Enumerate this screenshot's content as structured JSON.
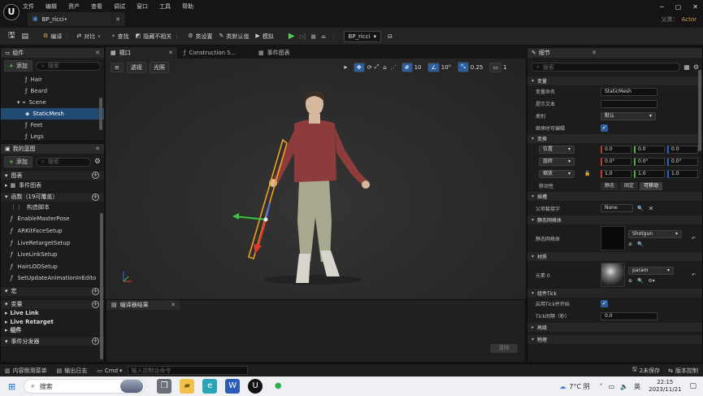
{
  "window": {
    "menu": [
      "文件",
      "编辑",
      "资产",
      "查看",
      "调试",
      "窗口",
      "工具",
      "帮助"
    ],
    "tab_title": "BP_ricci•",
    "parent_class_label": "父类：",
    "parent_class_value": "Actor",
    "logo_text": "U"
  },
  "toolbar": {
    "compile": "编译",
    "diff": "对比",
    "find": "查找",
    "hide_unrelated": "隐藏不相关",
    "class_settings": "类设置",
    "class_defaults": "类默认值",
    "simulate": "模拟",
    "debug_target": "BP_ricci"
  },
  "components": {
    "title": "组件",
    "add": "添加",
    "search_placeholder": "搜索",
    "items": [
      {
        "label": "Hair",
        "indent": 3
      },
      {
        "label": "Beard",
        "indent": 3
      },
      {
        "label": "Scene",
        "indent": 2
      },
      {
        "label": "StaticMesh",
        "indent": 3,
        "selected": true
      },
      {
        "label": "Feet",
        "indent": 3
      },
      {
        "label": "Legs",
        "indent": 3
      }
    ]
  },
  "my_blueprint": {
    "title": "我的蓝图",
    "add": "添加",
    "search_placeholder": "搜索",
    "graphs_header": "图表",
    "event_graph": "事件图表",
    "functions_header": "函数（19可覆盖）",
    "functions": [
      "构造脚本",
      "EnableMasterPose",
      "ARKitFaceSetup",
      "LiveRetargetSetup",
      "LiveLinkSetup",
      "HairLODSetup",
      "SetUpdateAnimationInEdito"
    ],
    "macros_header": "宏",
    "variables_header": "变量",
    "variable_groups": [
      "Live Link",
      "Live Retarget",
      "组件"
    ],
    "dispatchers_header": "事件分发器"
  },
  "editor_tabs": {
    "viewport": "视口",
    "construction": "Construction S...",
    "event_graph": "事件图表"
  },
  "viewport": {
    "perspective": "透视",
    "lit": "光照",
    "grid_snap": "10",
    "rot_snap": "10°",
    "scale_snap": "0.25",
    "camera_speed": "1"
  },
  "compiler": {
    "title": "编译器结果",
    "clear": "清除"
  },
  "details": {
    "title": "细节",
    "search_placeholder": "搜索",
    "variable_section": "变量",
    "var_name_label": "变量命名",
    "var_name_value": "StaticMesh",
    "tooltip_label": "提示文本",
    "category_label": "类别",
    "category_value": "默认",
    "editable_label": "继承时可编辑",
    "transform_section": "变换",
    "location_label": "位置",
    "location": [
      "0.0",
      "0.0",
      "0.0"
    ],
    "rotation_label": "旋转",
    "rotation": [
      "0.0°",
      "0.0°",
      "0.0°"
    ],
    "scale_label": "缩放",
    "scale": [
      "1.0",
      "1.0",
      "1.0"
    ],
    "mobility_label": "移动性",
    "mobility": [
      "静态",
      "固定",
      "可移动"
    ],
    "socket_section": "插槽",
    "parent_socket_label": "父项套接字",
    "parent_socket_value": "None",
    "static_mesh_section": "静态网格体",
    "static_mesh_label": "静态网格体",
    "static_mesh_value": "Shotgun",
    "materials_section": "材质",
    "element0_label": "元素 0",
    "element0_value": "param",
    "tick_section": "组件Tick",
    "tick_enabled_label": "启用Tick并开始",
    "tick_interval_label": "Tick间隔（秒）",
    "tick_interval_value": "0.0",
    "collapsed_1": "高级",
    "collapsed_2": "物理"
  },
  "statusbar": {
    "content_drawer": "内容侧滑菜单",
    "output_log": "输出日志",
    "cmd": "Cmd",
    "cmd_placeholder": "输入控制台命令",
    "unsaved": "2未保存",
    "source_control": "版本控制"
  },
  "taskbar": {
    "search": "搜索",
    "weather": "7°C 阴",
    "lang": "英",
    "time": "22:15",
    "date": "2023/11/21"
  },
  "colors": {
    "accent": "#2d5fa0",
    "play": "#58c858",
    "selected": "#214a72",
    "parent": "#c9a25b"
  }
}
